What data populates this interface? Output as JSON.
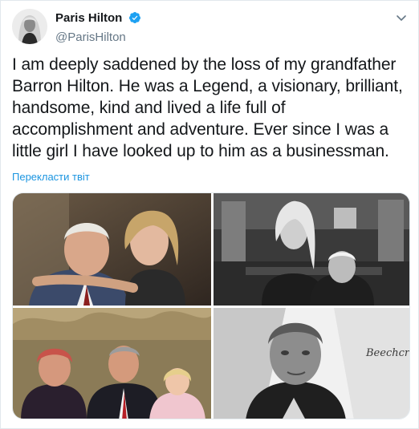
{
  "author": {
    "display_name": "Paris Hilton",
    "handle": "@ParisHilton",
    "verified": true
  },
  "tweet": {
    "text": "I am deeply saddened by the loss of my grandfather Barron Hilton. He was a Legend, a visionary, brilliant, handsome, kind and lived a life full of accomplishment and adventure. Ever since I was a little girl I have looked up to him as a businessman.",
    "translate_link": "Перекласти твіт"
  },
  "media": {
    "photo_4_sign_text": "Beechcraft"
  },
  "colors": {
    "link": "#1b95e0",
    "verified": "#1da1f2",
    "text": "#14171a",
    "secondary": "#657786"
  },
  "icons": {
    "verified": "verified-badge-icon",
    "menu": "chevron-down-icon"
  }
}
